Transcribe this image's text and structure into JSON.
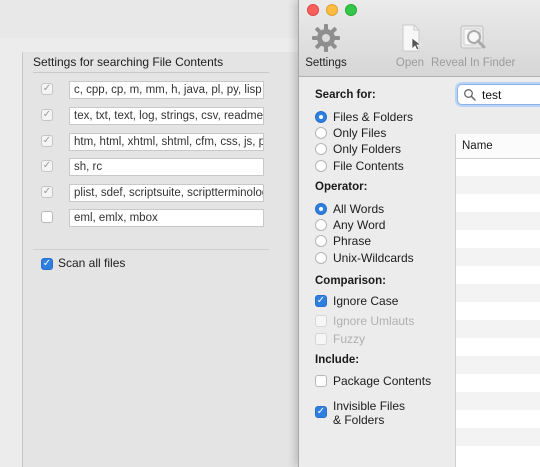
{
  "back_dialog": {
    "title": "Settings for searching File Contents",
    "rows": [
      {
        "checked": true,
        "text": "c, cpp, cp, m, mm, h, java, pl, py, lisp"
      },
      {
        "checked": true,
        "text": "tex, txt, text, log, strings, csv, readme"
      },
      {
        "checked": true,
        "text": "htm, html, xhtml, shtml, cfm, css, js, php"
      },
      {
        "checked": true,
        "text": "sh, rc"
      },
      {
        "checked": true,
        "text": "plist, sdef, scriptsuite, scriptterminology"
      },
      {
        "checked": false,
        "text": "eml, emlx, mbox"
      }
    ],
    "scan_all_label": "Scan all files",
    "scan_all_checked": true
  },
  "toolbar": {
    "settings_label": "Settings",
    "settings_icon": "gear-icon",
    "open_label": "Open",
    "open_icon": "document-icon",
    "reveal_label": "Reveal In Finder",
    "reveal_icon": "finder-magnify-icon"
  },
  "search": {
    "value": "test",
    "icon": "search-icon"
  },
  "search_for": {
    "heading": "Search for:",
    "options": [
      "Files & Folders",
      "Only Files",
      "Only Folders",
      "File Contents"
    ],
    "selected_index": 0
  },
  "operator": {
    "heading": "Operator:",
    "options": [
      "All Words",
      "Any Word",
      "Phrase",
      "Unix-Wildcards"
    ],
    "selected_index": 0
  },
  "comparison": {
    "heading": "Comparison:",
    "ignore_case": "Ignore Case",
    "ignore_umlauts": "Ignore Umlauts",
    "fuzzy": "Fuzzy"
  },
  "include": {
    "heading": "Include:",
    "package_contents": "Package Contents",
    "invisible_line1": "Invisible Files",
    "invisible_line2": "& Folders"
  },
  "results": {
    "column_name": "Name"
  },
  "colors": {
    "accent": "#2f7fe0",
    "close": "#fc605c",
    "minimize": "#fdbc40",
    "zoom": "#34c84a"
  }
}
